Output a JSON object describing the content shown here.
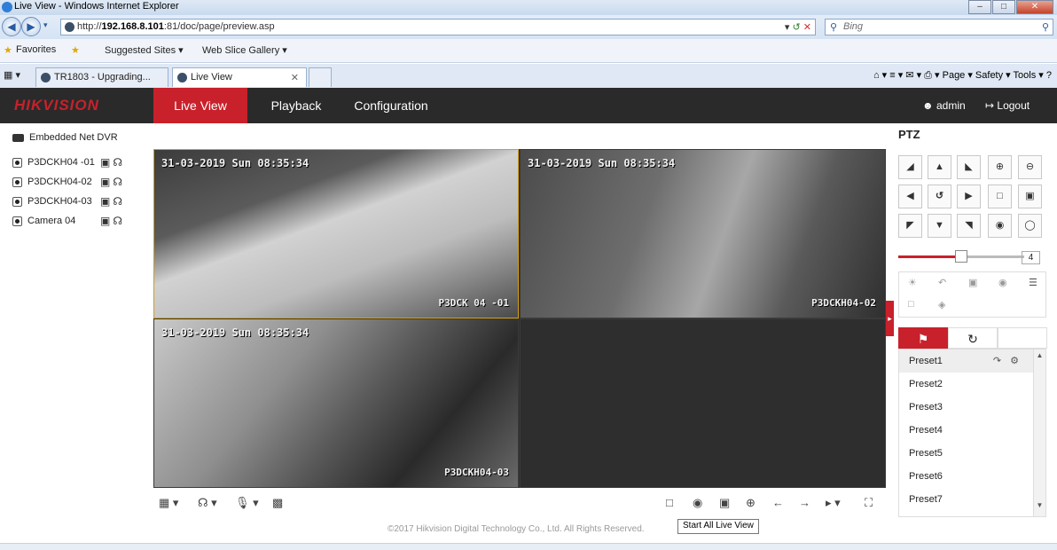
{
  "browser": {
    "window_title": "Live View - Windows Internet Explorer",
    "url_prefix": "http://",
    "url_host": "192.168.8.101",
    "url_rest": ":81/doc/page/preview.asp",
    "search_placeholder": "Bing",
    "favorites_label": "Favorites",
    "fav_items": [
      "Suggested Sites ▾",
      "Web Slice Gallery ▾"
    ],
    "tabs": [
      "TR1803 - Upgrading...",
      "Live View"
    ],
    "commands": "Page ▾  Safety ▾  Tools ▾"
  },
  "app": {
    "logo_main": "HIK",
    "logo_rest": "VISION",
    "nav": [
      "Live View",
      "Playback",
      "Configuration"
    ],
    "user": "admin",
    "logout": "Logout"
  },
  "device_tree": {
    "root": "Embedded Net DVR",
    "cameras": [
      "P3DCKH04 -01",
      "P3DCKH04-02",
      "P3DCKH04-03",
      "Camera 04"
    ]
  },
  "video": {
    "tiles": [
      {
        "osd": "31-03-2019 Sun 08:35:34",
        "label": "P3DCK 04 -01"
      },
      {
        "osd": "31-03-2019 Sun 08:35:34",
        "label": "P3DCKH04-02"
      },
      {
        "osd": "31-03-2019 Sun 08:35:34",
        "label": "P3DCKH04-03"
      }
    ]
  },
  "footer": "©2017 Hikvision Digital Technology Co., Ltd. All Rights Reserved.",
  "tooltip": "Start All Live View",
  "ptz": {
    "title": "PTZ",
    "speed": "4",
    "presets": [
      "Preset1",
      "Preset2",
      "Preset3",
      "Preset4",
      "Preset5",
      "Preset6",
      "Preset7"
    ]
  },
  "colors": {
    "brand_red": "#c8212b",
    "nav_bg": "#2a2a2a"
  }
}
